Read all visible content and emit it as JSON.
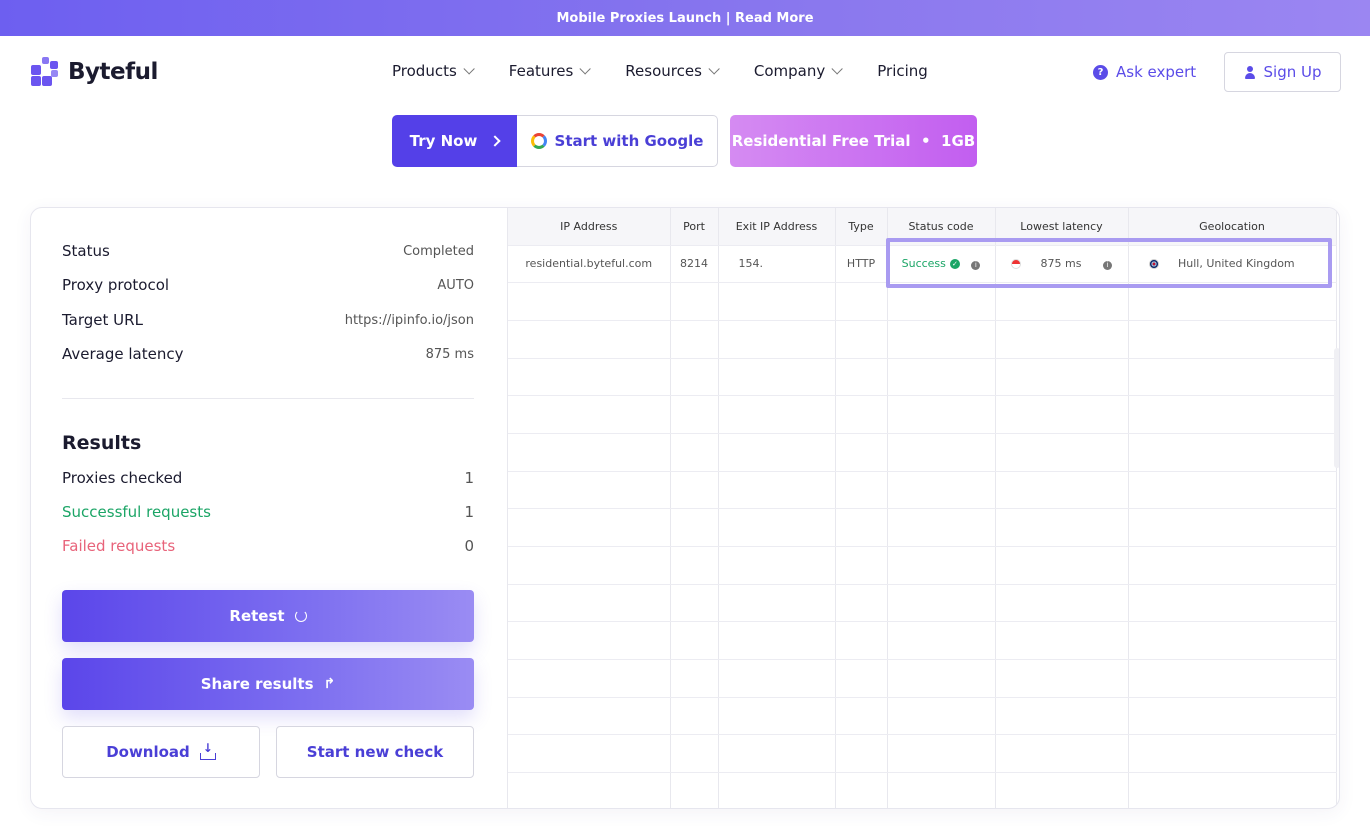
{
  "banner": {
    "text": "Mobile Proxies Launch | Read More"
  },
  "header": {
    "brand": "Byteful",
    "nav": [
      {
        "label": "Products",
        "has_dropdown": true
      },
      {
        "label": "Features",
        "has_dropdown": true
      },
      {
        "label": "Resources",
        "has_dropdown": true
      },
      {
        "label": "Company",
        "has_dropdown": true
      },
      {
        "label": "Pricing",
        "has_dropdown": false
      }
    ],
    "ask_expert": "Ask expert",
    "sign_up": "Sign Up"
  },
  "cta": {
    "try_now": "Try Now",
    "google": "Start with Google",
    "trial": "Residential Free Trial  •  1GB"
  },
  "summary": {
    "status": {
      "label": "Status",
      "value": "Completed"
    },
    "protocol": {
      "label": "Proxy protocol",
      "value": "AUTO"
    },
    "target": {
      "label": "Target URL",
      "value": "https://ipinfo.io/json"
    },
    "latency": {
      "label": "Average latency",
      "value": "875 ms"
    }
  },
  "results": {
    "title": "Results",
    "checked": {
      "label": "Proxies checked",
      "value": "1"
    },
    "success": {
      "label": "Successful requests",
      "value": "1"
    },
    "failed": {
      "label": "Failed requests",
      "value": "0"
    }
  },
  "actions": {
    "retest": "Retest",
    "share": "Share results",
    "download": "Download",
    "new_check": "Start new check"
  },
  "table": {
    "headers": [
      "IP Address",
      "Port",
      "Exit IP Address",
      "Type",
      "Status code",
      "Lowest latency",
      "Geolocation"
    ],
    "row": {
      "ip": "residential.byteful.com",
      "port": "8214",
      "exit_ip": "154.",
      "type": "HTTP",
      "status": "Success",
      "latency": "875 ms",
      "geo": "Hull, United Kingdom"
    }
  },
  "colors": {
    "accent": "#5440e8",
    "success": "#1ba566",
    "failed": "#e8637a"
  }
}
